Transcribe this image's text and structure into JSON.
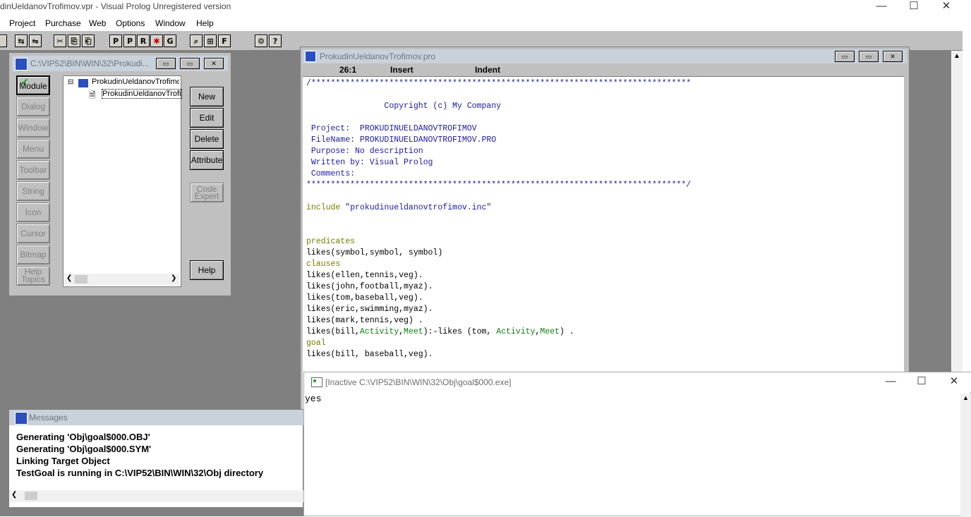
{
  "app": {
    "title": "dinUeldanovTrofimov.vpr - Visual Prolog Unregistered version",
    "minimize": "—",
    "maximize": "☐",
    "close": "✕"
  },
  "menu": [
    "Project",
    "Purchase",
    "Web",
    "Options",
    "Window",
    "Help"
  ],
  "toolbar": [
    "⇆",
    "⇋",
    "✂",
    "⎘",
    "⎗",
    "P",
    "P",
    "R",
    "✱",
    "G",
    "⌕",
    "⊞",
    "F",
    "⚙",
    "?"
  ],
  "project_window": {
    "title": "C:\\VIP52\\BIN\\WIN\\32\\Prokudi...",
    "controls": [
      "▭",
      "▭",
      "✕"
    ],
    "left_buttons": [
      "Module",
      "Dialog",
      "Window",
      "Menu",
      "Toolbar",
      "String",
      "Icon",
      "Cursor",
      "Bitmap",
      "Help Topics"
    ],
    "right_buttons": [
      "New",
      "Edit",
      "Delete",
      "Attribute",
      "Code Expert",
      "Help"
    ],
    "tree": {
      "root": "ProkudinUeldanovTrofimov",
      "child": "ProkudinUeldanovTrofi",
      "expand": "⊟"
    }
  },
  "editor": {
    "title": "ProkudinUeldanovTrofimov.pro",
    "controls": [
      "▭",
      "▭",
      "✕"
    ],
    "status": {
      "position": "26:1",
      "mode": "Insert",
      "indent": "Indent"
    },
    "lines": [
      {
        "text": "/******************************************************************************",
        "cls": "com"
      },
      {
        "text": "",
        "cls": ""
      },
      {
        "text": "                Copyright (c) My Company",
        "cls": "com"
      },
      {
        "text": "",
        "cls": ""
      },
      {
        "text": " Project:  PROKUDINUELDANOVTROFIMOV",
        "cls": "com"
      },
      {
        "text": " FileName: PROKUDINUELDANOVTROFIMOV.PRO",
        "cls": "com"
      },
      {
        "text": " Purpose: No description",
        "cls": "com"
      },
      {
        "text": " Written by: Visual Prolog",
        "cls": "com"
      },
      {
        "text": " Comments:",
        "cls": "com"
      },
      {
        "text": "******************************************************************************/",
        "cls": "com"
      },
      {
        "text": "",
        "cls": ""
      },
      {
        "text": "include \"prokudinueldanovtrofimov.inc\"",
        "cls": "inc"
      },
      {
        "text": "",
        "cls": ""
      },
      {
        "text": "",
        "cls": ""
      },
      {
        "text": "predicates",
        "cls": "kw"
      },
      {
        "text": "likes(symbol,symbol, symbol)",
        "cls": ""
      },
      {
        "text": "clauses",
        "cls": "kw"
      },
      {
        "text": "likes(ellen,tennis,veg).",
        "cls": ""
      },
      {
        "text": "likes(john,football,myaz).",
        "cls": ""
      },
      {
        "text": "likes(tom,baseball,veg).",
        "cls": ""
      },
      {
        "text": "likes(eric,swimming,myaz).",
        "cls": ""
      },
      {
        "text": "likes(mark,tennis,veg) .",
        "cls": ""
      },
      {
        "text": "likes(bill,Activity,Meet):-likes (tom, Activity,Meet) .",
        "cls": "rule"
      },
      {
        "text": "goal",
        "cls": "kw"
      },
      {
        "text": "likes(bill, baseball,veg).",
        "cls": ""
      }
    ]
  },
  "messages": {
    "title": "Messages",
    "lines": [
      "Generating 'Obj\\goal$000.OBJ'",
      "Generating 'Obj\\goal$000.SYM'",
      "Linking Target Object",
      "TestGoal is running in C:\\VIP52\\BIN\\WIN\\32\\Obj directory"
    ]
  },
  "console": {
    "title": "[Inactive C:\\VIP52\\BIN\\WIN\\32\\Obj\\goal$000.exe]",
    "output": "yes",
    "minimize": "—",
    "maximize": "☐",
    "close": "✕"
  },
  "colors": {
    "mdi_bg": "#808080",
    "face": "#c0c0c0",
    "inactive_caption": "#c9d1db",
    "comment": "#1a1aa8",
    "keyword": "#7a7a00",
    "variable": "#118011"
  }
}
